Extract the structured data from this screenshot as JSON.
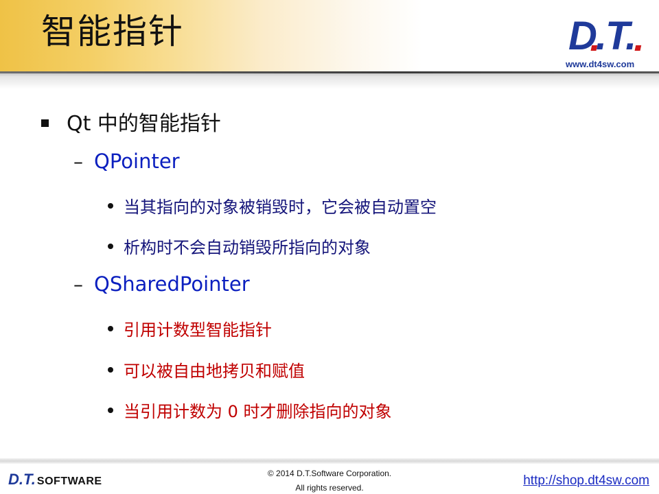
{
  "slide": {
    "title": "智能指针"
  },
  "logo": {
    "mark": "D.T.",
    "url": "www.dt4sw.com"
  },
  "bullets": {
    "level1": "Qt 中的智能指针",
    "qpointer": {
      "label": "QPointer",
      "items": [
        "当其指向的对象被销毁时，它会被自动置空",
        "析构时不会自动销毁所指向的对象"
      ]
    },
    "qsharedpointer": {
      "label": "QSharedPointer",
      "items": [
        "引用计数型智能指针",
        "可以被自由地拷贝和赋值",
        "当引用计数为 0 时才删除指向的对象"
      ]
    }
  },
  "footer": {
    "brand_dt": "D.T.",
    "brand_software": "SOFTWARE",
    "copyright_line1": "© 2014 D.T.Software Corporation.",
    "copyright_line2": "All rights reserved.",
    "link": "http://shop.dt4sw.com"
  },
  "colors": {
    "title_band": "#efc246",
    "level2_blue": "#0b1fbf",
    "level3_blue": "#14147a",
    "level3_red": "#c00000",
    "link_blue": "#1a2bc2"
  }
}
